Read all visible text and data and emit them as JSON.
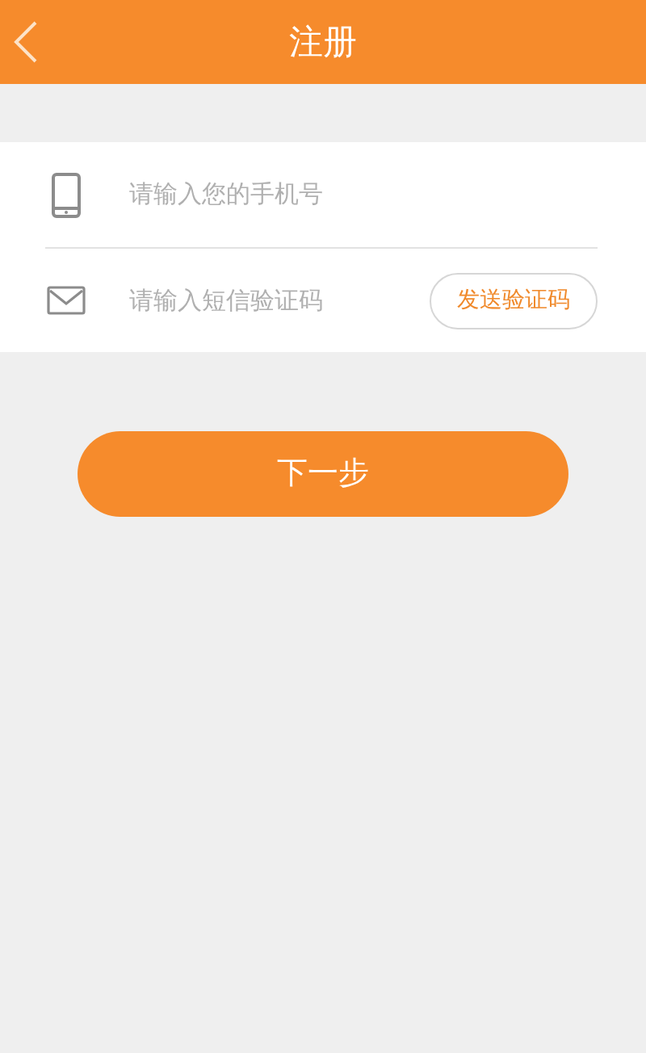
{
  "header": {
    "title": "注册"
  },
  "fields": [
    {
      "kind": "phone",
      "placeholder": "请输入您的手机号"
    },
    {
      "kind": "sms",
      "placeholder": "请输入短信验证码",
      "action": "发送验证码"
    }
  ],
  "next_button": "下一步"
}
